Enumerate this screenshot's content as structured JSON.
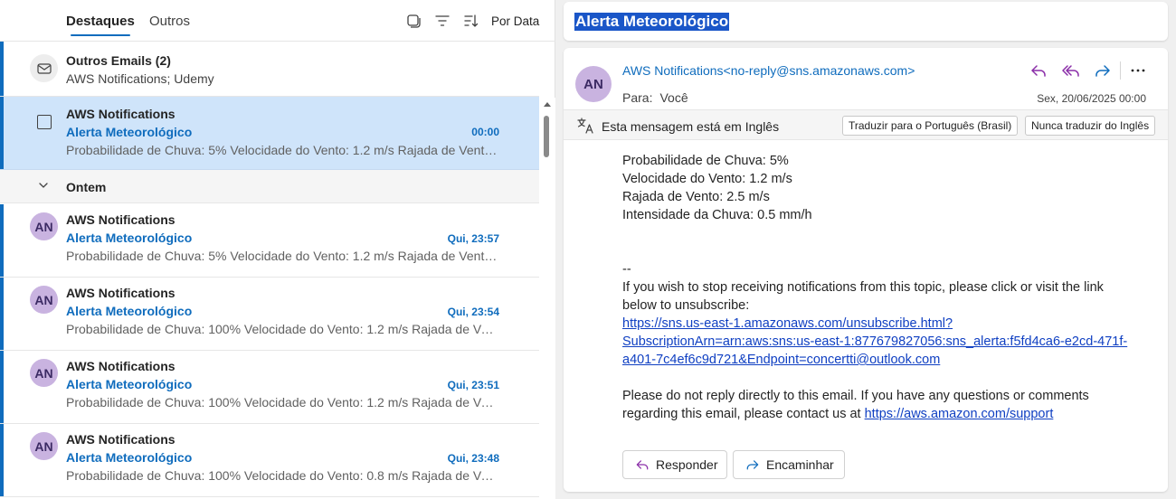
{
  "list": {
    "tabs": {
      "focused": "Destaques",
      "other": "Outros"
    },
    "sort_label": "Por Data",
    "other_mail": {
      "title": "Outros Emails (2)",
      "senders": "AWS Notifications; Udemy"
    },
    "selected": {
      "sender": "AWS Notifications",
      "subject": "Alerta Meteorológico",
      "time": "00:00",
      "preview": "Probabilidade de Chuva: 5% Velocidade do Vento: 1.2 m/s Rajada de Vento: ..."
    },
    "group_label": "Ontem",
    "items": [
      {
        "initials": "AN",
        "sender": "AWS Notifications",
        "subject": "Alerta Meteorológico",
        "time": "Qui, 23:57",
        "preview": "Probabilidade de Chuva: 5% Velocidade do Vento: 1.2 m/s Rajada de Vento: ..."
      },
      {
        "initials": "AN",
        "sender": "AWS Notifications",
        "subject": "Alerta Meteorológico",
        "time": "Qui, 23:54",
        "preview": "Probabilidade de Chuva: 100% Velocidade do Vento: 1.2 m/s Rajada de Vent..."
      },
      {
        "initials": "AN",
        "sender": "AWS Notifications",
        "subject": "Alerta Meteorológico",
        "time": "Qui, 23:51",
        "preview": "Probabilidade de Chuva: 100% Velocidade do Vento: 1.2 m/s Rajada de Vent..."
      },
      {
        "initials": "AN",
        "sender": "AWS Notifications",
        "subject": "Alerta Meteorológico",
        "time": "Qui, 23:48",
        "preview": "Probabilidade de Chuva: 100% Velocidade do Vento: 0.8 m/s Rajada de Vent..."
      }
    ]
  },
  "reading": {
    "subject": "Alerta Meteorológico",
    "avatar_initials": "AN",
    "from": "AWS Notifications<no-reply@sns.amazonaws.com>",
    "to_label": "Para:",
    "to_value": "Você",
    "date": "Sex, 20/06/2025 00:00",
    "translate": {
      "message": "Esta mensagem está em Inglês",
      "translate_button": "Traduzir para o Português (Brasil)",
      "never_button": "Nunca traduzir do Inglês"
    },
    "body": {
      "line1": "Probabilidade de Chuva: 5%",
      "line2": "Velocidade do Vento: 1.2 m/s",
      "line3": "Rajada de Vento: 2.5 m/s",
      "line4": "Intensidade da Chuva: 0.5 mm/h",
      "sig": "--",
      "unsub1": "If you wish to stop receiving notifications from this topic, please click or visit the link",
      "unsub2": "below to unsubscribe:",
      "link1": "https://sns.us-east-1.amazonaws.com/unsubscribe.html?",
      "link2": "SubscriptionArn=arn:aws:sns:us-east-1:877679827056:sns_alerta:f5fd4ca6-e2cd-471f-",
      "link3": "a401-7c4ef6c9d721&Endpoint=concertti@outlook.com",
      "note1": "Please do not reply directly to this email. If you have any questions or comments",
      "note2": "regarding this email, please contact us at",
      "support_link": "https://aws.amazon.com/support"
    },
    "reply_button": "Responder",
    "forward_button": "Encaminhar"
  },
  "colors": {
    "accent": "#0f6cbd",
    "avatar_bg": "#c9b3e0",
    "selected_bg": "#cfe4fa",
    "reply_icon": "#8a2da8"
  }
}
